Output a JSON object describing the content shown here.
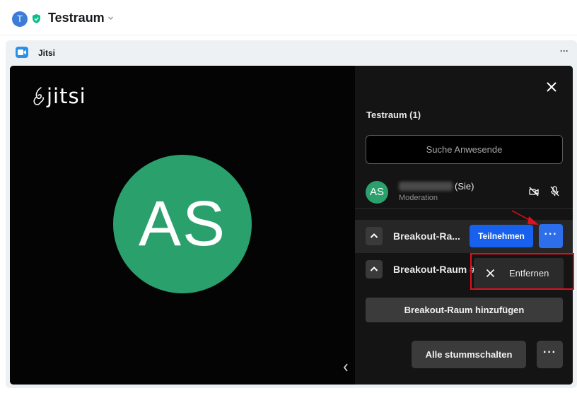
{
  "header": {
    "room_initial": "T",
    "room_name": "Testraum"
  },
  "widget": {
    "title": "Jitsi",
    "menu_label": "···"
  },
  "conference": {
    "logo_text": "jitsi",
    "speaker_initials": "AS"
  },
  "participants": {
    "title": "Testraum (1)",
    "search_placeholder": "Suche Anwesende",
    "me": {
      "initials": "AS",
      "suffix": "(Sie)",
      "role": "Moderation"
    },
    "breakout_rooms": [
      {
        "name": "Breakout-Ra...",
        "join_label": "Teilnehmen",
        "more_label": "···"
      },
      {
        "name": "Breakout-Raum #"
      }
    ],
    "context_menu": {
      "remove_label": "Entfernen"
    },
    "add_room_label": "Breakout-Raum hinzufügen",
    "mute_all_label": "Alle stummschalten",
    "more_label": "···"
  },
  "colors": {
    "accent_blue": "#1761ee",
    "avatar_green": "#2aa06d",
    "annotation_red": "#e0101d"
  }
}
